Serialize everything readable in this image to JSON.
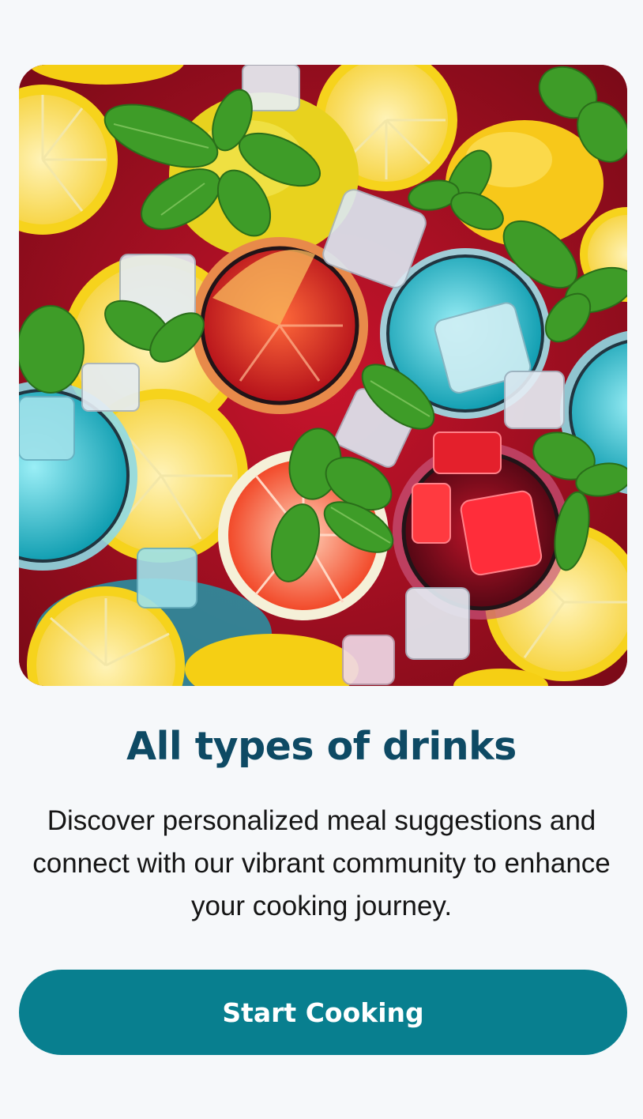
{
  "hero": {
    "image_name": "colorful-drinks-photo",
    "colors": {
      "background": "#b8102a",
      "lemon": "#f6d31c",
      "lemon_flesh": "#fbe27a",
      "mint": "#3b9a2a",
      "blue_drink": "#29c3d3",
      "red_drink": "#e0281f",
      "ice": "#e8eef5"
    }
  },
  "title": "All types of drinks",
  "description": "Discover personalized meal suggestions and connect with our vibrant community to enhance your cooking journey.",
  "cta": {
    "label": "Start Cooking",
    "color": "#087f8f"
  }
}
